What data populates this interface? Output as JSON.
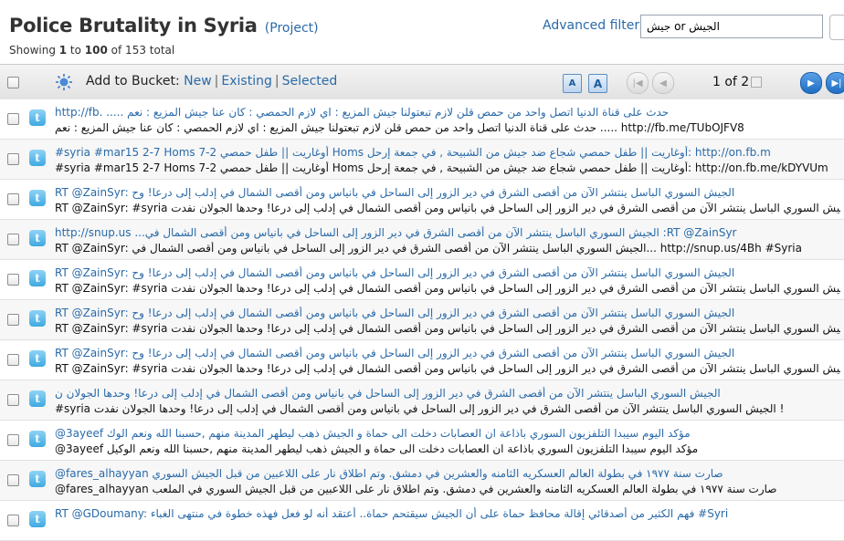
{
  "header": {
    "title": "Police Brutality in Syria",
    "project_link": "(Project)",
    "showing_prefix": "Showing ",
    "range_start": "1",
    "range_to": " to ",
    "range_end": "100",
    "range_of": " of 153 total",
    "advanced_filters": "Advanced filters",
    "search_value": "جيش or الجيش"
  },
  "toolbar": {
    "add_to_bucket": "Add to Bucket:",
    "new": "New",
    "existing": "Existing",
    "selected": "Selected",
    "page_indicator": "1 of 2",
    "font_small": "A",
    "font_large": "A",
    "icons": [
      "sun-icon",
      "first-page-icon",
      "prev-page-icon",
      "next-page-icon",
      "last-page-icon"
    ]
  },
  "tweets": [
    {
      "line1": "http://fb. ..... حدث على قناة الدنيا اتصل واحد من حمص قلن لازم تبعتولنا جيش المزيع : اي لازم الحمصي : كان عنا جيش المزيع : نعم",
      "line2": "حدث على قناة الدنيا اتصل واحد من حمص قلن لازم تبعتولنا جيش المزيع : اي لازم الحمصي : كان عنا جيش المزيع : نعم ..... http://fb.me/TUbOJFV8"
    },
    {
      "line1": "#syria #mar15 2-7 Homs 7-2 أوغاريت || طفل حمصي Homs أوغاريت || طفل حمصي شجاع ضد جيش من الشبيحة , في جمعة إرحل: http://on.fb.m",
      "line2": "#syria #mar15 2-7 Homs 7-2 أوغاريت || طفل حمصي Homs أوغاريت || طفل حمصي شجاع ضد جيش من الشبيحة , في جمعة إرحل: http://on.fb.me/kDYVUm"
    },
    {
      "line1": "RT @ZainSyr: الجيش السوري الباسل ينتشر الآن من أقصى الشرق في دير الزور إلى الساحل في بانياس ومن أقصى الشمال في إدلب إلى درعا! وح",
      "line2": "RT @ZainSyr: #syria الجيش السوري الباسل ينتشر الآن من أقصى الشرق في دير الزور إلى الساحل في بانياس ومن أقصى الشمال في إدلب إلى درعا! وحدها الجولان نفدت !"
    },
    {
      "line1": "http://snup.us ...الجيش السوري الباسل ينتشر الآن من أقصى الشرق في دير الزور إلى الساحل في بانياس ومن أقصى الشمال في :RT @ZainSyr",
      "line2": "RT @ZainSyr: الجيش السوري الباسل ينتشر الآن من أقصى الشرق في دير الزور إلى الساحل في بانياس ومن أقصى الشمال في... http://snup.us/4Bh #Syria"
    },
    {
      "line1": "RT @ZainSyr: الجيش السوري الباسل ينتشر الآن من أقصى الشرق في دير الزور إلى الساحل في بانياس ومن أقصى الشمال في إدلب إلى درعا! وح",
      "line2": "RT @ZainSyr: #syria الجيش السوري الباسل ينتشر الآن من أقصى الشرق في دير الزور إلى الساحل في بانياس ومن أقصى الشمال في إدلب إلى درعا! وحدها الجولان نفدت !"
    },
    {
      "line1": "RT @ZainSyr: الجيش السوري الباسل ينتشر الآن من أقصى الشرق في دير الزور إلى الساحل في بانياس ومن أقصى الشمال في إدلب إلى درعا! وح",
      "line2": "RT @ZainSyr: #syria الجيش السوري الباسل ينتشر الآن من أقصى الشرق في دير الزور إلى الساحل في بانياس ومن أقصى الشمال في إدلب إلى درعا! وحدها الجولان نفدت !"
    },
    {
      "line1": "RT @ZainSyr: الجيش السوري الباسل ينتشر الآن من أقصى الشرق في دير الزور إلى الساحل في بانياس ومن أقصى الشمال في إدلب إلى درعا! وح",
      "line2": "RT @ZainSyr: #syria الجيش السوري الباسل ينتشر الآن من أقصى الشرق في دير الزور إلى الساحل في بانياس ومن أقصى الشمال في إدلب إلى درعا! وحدها الجولان نفدت !"
    },
    {
      "line1": "الجيش السوري الباسل ينتشر الآن من أقصى الشرق في دير الزور إلى الساحل في بانياس ومن أقصى الشمال في إدلب إلى درعا! وحدها الجولان ن",
      "line2": "#syria الجيش السوري الباسل ينتشر الآن من أقصى الشرق في دير الزور إلى الساحل في بانياس ومن أقصى الشمال في إدلب إلى درعا! وحدها الجولان نفدت !"
    },
    {
      "line1": "@3ayeef مؤكد اليوم سيبدا التلفزيون السوري باذاعة ان العصابات دخلت الى حماة و الجيش ذهب ليطهر المدينة منهم ,حسبنا الله ونعم الوك",
      "line2": "@3ayeef مؤكد اليوم سيبدا التلفزيون السوري باذاعة ان العصابات دخلت الى حماة و الجيش ذهب ليطهر المدينة منهم ,حسبنا الله ونعم الوكيل"
    },
    {
      "line1": "@fares_alhayyan صارت سنة ١٩٧٧ في بطولة العالم العسكريه الثامنه والعشرين في دمشق. وتم اطلاق نار على اللاعبين من قبل الجيش السوري",
      "line2": "@fares_alhayyan صارت سنة ١٩٧٧ في بطولة العالم العسكريه الثامنه والعشرين في دمشق. وتم اطلاق نار على اللاعبين من قبل الجيش السوري في الملعب"
    },
    {
      "line1": "RT @GDoumany: فهم الكثير من أصدقائي إقالة محافظ حماة على أن الجيش سيقتحم حماة.. أعتقد أنه لو فعل فهذه خطوة في منتهى الغباء #Syri",
      "line2": ""
    }
  ]
}
